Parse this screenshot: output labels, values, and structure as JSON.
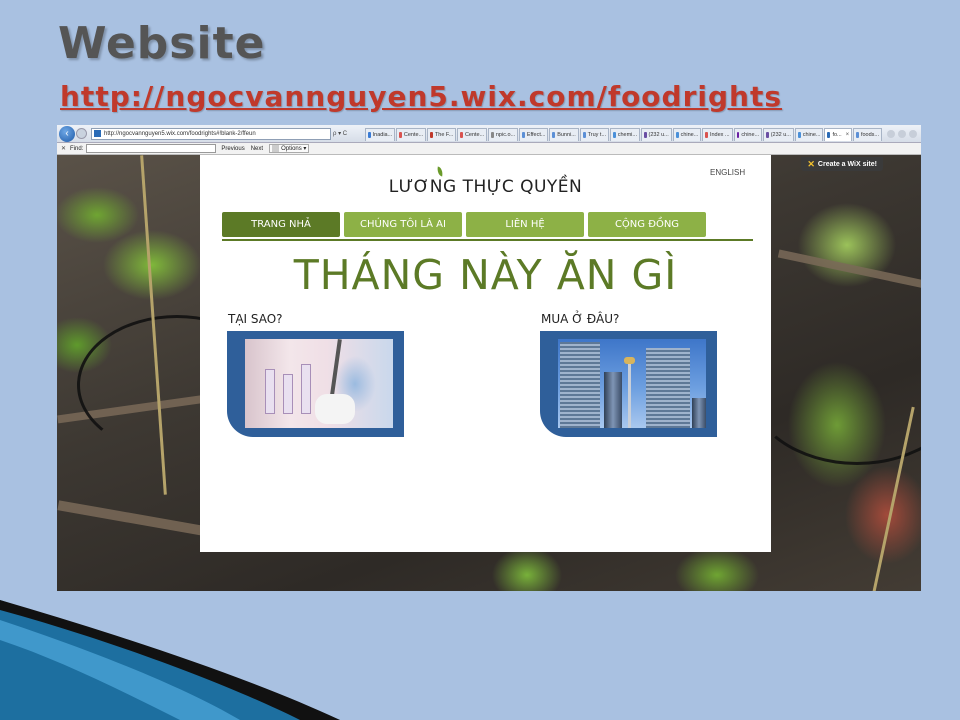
{
  "slide": {
    "title": "Website",
    "link": "http://ngocvannguyen5.wix.com/foodrights"
  },
  "browser": {
    "url": "http://ngocvannguyen5.wix.com/foodrights#!blank-2/ffeun",
    "url_controls": "ρ ▾ C",
    "tabs": [
      {
        "label": "Inadia...",
        "icon_color": "#3a7bd5"
      },
      {
        "label": "Cente...",
        "icon_color": "#d9534f"
      },
      {
        "label": "The F...",
        "icon_color": "#c0392b"
      },
      {
        "label": "Cente...",
        "icon_color": "#d9534f"
      },
      {
        "label": "npic.o...",
        "icon_color": "#888888"
      },
      {
        "label": "Effect...",
        "icon_color": "#5b8fd6"
      },
      {
        "label": "Bunni...",
        "icon_color": "#5b8fd6"
      },
      {
        "label": "Truy t...",
        "icon_color": "#5b8fd6"
      },
      {
        "label": "chemi...",
        "icon_color": "#4a90d9"
      },
      {
        "label": "(232 u...",
        "icon_color": "#6a4ea3"
      },
      {
        "label": "chine...",
        "icon_color": "#4a90d9"
      },
      {
        "label": "Index ...",
        "icon_color": "#d9534f"
      },
      {
        "label": "chine...",
        "icon_color": "#6a1fa3"
      },
      {
        "label": "(232 u...",
        "icon_color": "#6a4ea3"
      },
      {
        "label": "chine...",
        "icon_color": "#4a90d9"
      },
      {
        "label": "fo...",
        "icon_color": "#2a6bb7",
        "active": true
      },
      {
        "label": "foods...",
        "icon_color": "#5b8fd6"
      }
    ],
    "find": {
      "close": "✕",
      "label": "Find:",
      "value": "",
      "previous": "Previous",
      "next": "Next",
      "options": "Options ▾"
    }
  },
  "wix_badge": {
    "label": "Create a WiX site!"
  },
  "site": {
    "language": "ENGLISH",
    "logo": "LƯƠNG THỰC QUYỀN",
    "nav": [
      {
        "label": "TRANG NHẢ",
        "active": true
      },
      {
        "label": "CHÚNG TÔI LÀ AI",
        "active": false
      },
      {
        "label": "LIÊN HỆ",
        "active": false
      },
      {
        "label": "CỘNG ĐỒNG",
        "active": false
      }
    ],
    "headline": "THÁNG NÀY ĂN GÌ",
    "sections": [
      {
        "label": "TẠI SAO?"
      },
      {
        "label": "MUA Ở ĐÂU?"
      }
    ]
  },
  "colors": {
    "slide_bg": "#a9c1e1",
    "title_gray": "#555555",
    "link_red": "#c0392b",
    "nav_green": "#8db146",
    "nav_active_green": "#5c7a26",
    "card_blue": "#2f5f9a"
  }
}
